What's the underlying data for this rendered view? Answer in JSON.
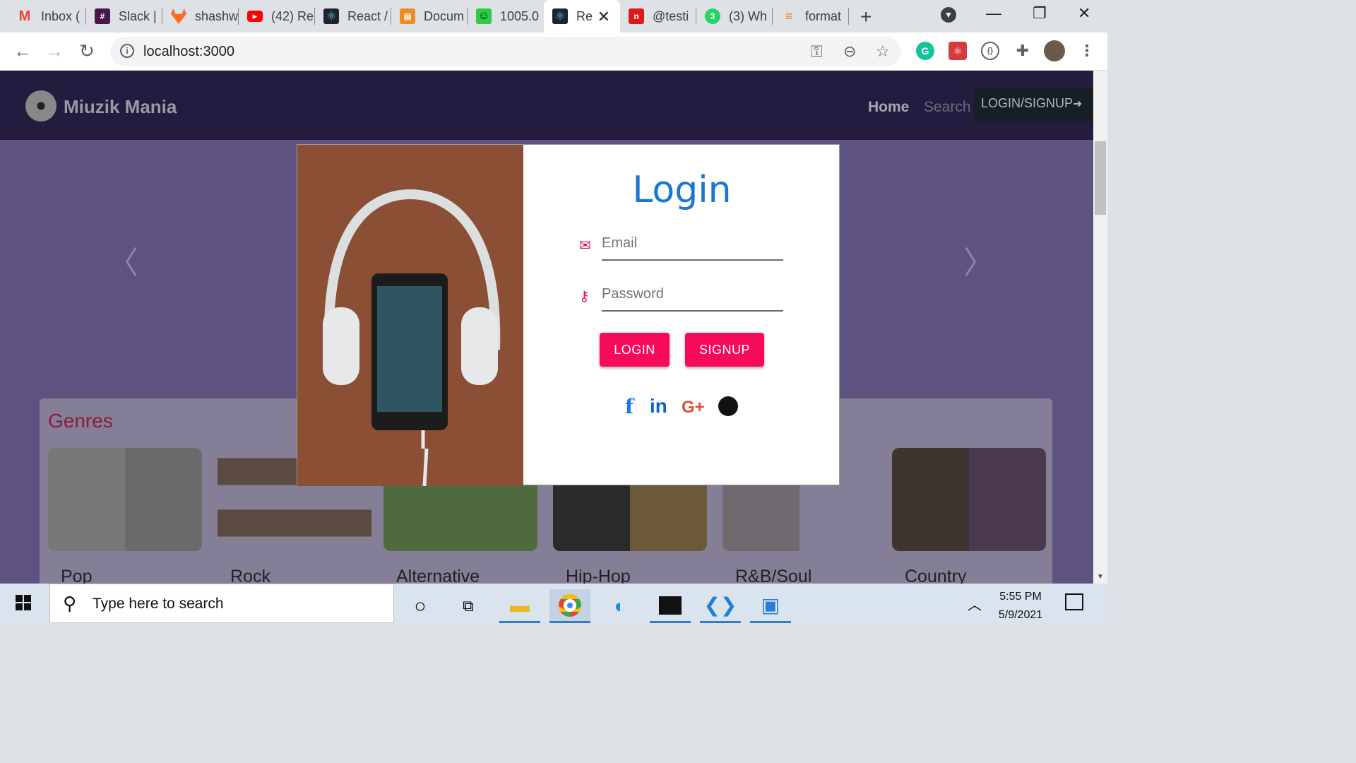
{
  "browser": {
    "tabs": [
      {
        "label": "Inbox (",
        "favicon": "gmail-icon",
        "color": "#ea4335"
      },
      {
        "label": "Slack |",
        "favicon": "slack-icon",
        "color": "#4a154b"
      },
      {
        "label": "shashw",
        "favicon": "gitlab-icon",
        "color": "#fc6d26"
      },
      {
        "label": "(42) Re",
        "favicon": "youtube-icon",
        "color": "#ff0000"
      },
      {
        "label": "React /",
        "favicon": "react-icon",
        "color": "#20232a"
      },
      {
        "label": "Docum",
        "favicon": "docusaurus-icon",
        "color": "#f08a24"
      },
      {
        "label": "1005.0",
        "favicon": "smiley-icon",
        "color": "#2ecc40"
      },
      {
        "label": "Re",
        "favicon": "react-icon",
        "color": "#20232a",
        "active": true
      },
      {
        "label": "@testi",
        "favicon": "n-icon",
        "color": "#d81b1b"
      },
      {
        "label": "(3) Wh",
        "favicon": "whatsapp-icon",
        "color": "#25d366"
      },
      {
        "label": "format",
        "favicon": "stackoverflow-icon",
        "color": "#f48024"
      }
    ],
    "url": "localhost:3000"
  },
  "navbar": {
    "brand": "Miuzik Mania",
    "home": "Home",
    "search": "Search",
    "login_signup": "LOGIN/SIGNUP"
  },
  "modal": {
    "title": "Login",
    "email_placeholder": "Email",
    "password_placeholder": "Password",
    "login_button": "LOGIN",
    "signup_button": "SIGNUP",
    "social": [
      {
        "icon": "facebook-icon",
        "glyph": "f",
        "color": "#1877f2"
      },
      {
        "icon": "linkedin-icon",
        "glyph": "in",
        "color": "#0a66c2"
      },
      {
        "icon": "google-plus-icon",
        "glyph": "G+",
        "color": "#dd4b39"
      },
      {
        "icon": "github-icon",
        "glyph": "◉",
        "color": "#111111"
      }
    ]
  },
  "genres": {
    "title": "Genres",
    "items": [
      "Pop",
      "Rock",
      "Alternative",
      "Hip-Hop",
      "R&B/Soul",
      "Country"
    ]
  },
  "taskbar": {
    "search_placeholder": "Type here to search",
    "time": "5:55 PM",
    "date": "5/9/2021"
  }
}
